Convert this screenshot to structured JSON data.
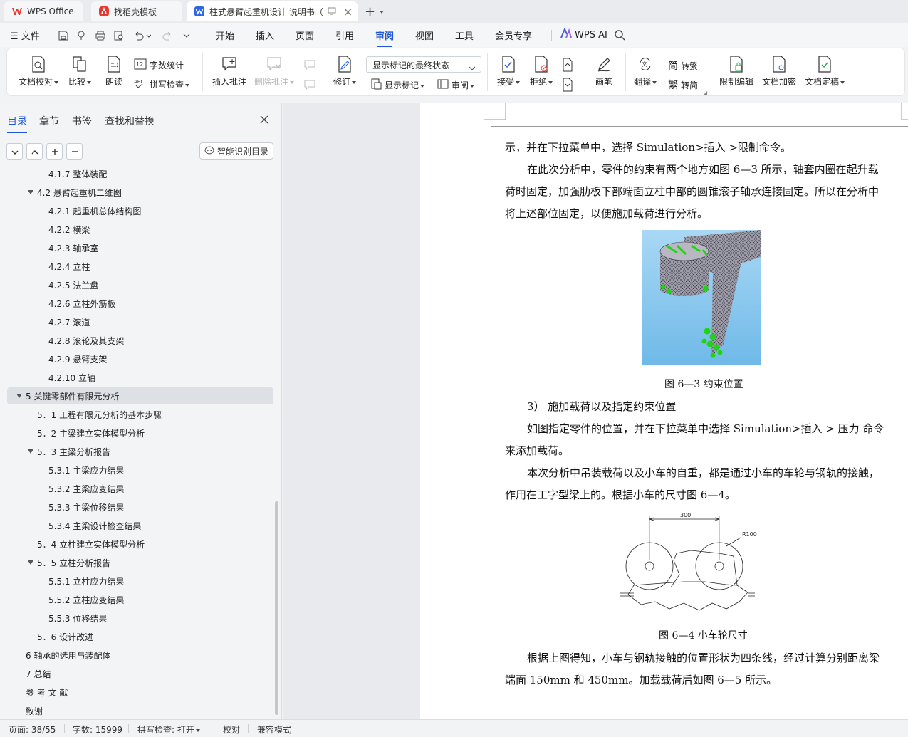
{
  "tabs": {
    "wps": "WPS Office",
    "template": "找稻壳模板",
    "document": "柱式悬臂起重机设计 说明书（",
    "close": "×",
    "new": "+"
  },
  "menu": {
    "file": "文件",
    "items": [
      "开始",
      "插入",
      "页面",
      "引用",
      "审阅",
      "视图",
      "工具",
      "会员专享"
    ],
    "active": "审阅",
    "wps_ai": "WPS AI"
  },
  "ribbon": {
    "doc_proof": "文档校对",
    "compare": "比较",
    "read_aloud": "朗读",
    "word_count": "字数统计",
    "spell_check": "拼写检查",
    "insert_comment": "插入批注",
    "delete_comment": "删除批注",
    "track_changes": "修订",
    "markup_state": "显示标记的最终状态",
    "show_markup": "显示标记",
    "review": "审阅",
    "accept": "接受",
    "reject": "拒绝",
    "pen": "画笔",
    "translate": "翻译",
    "to_traditional": "转繁",
    "to_simplified": "转简",
    "restrict_edit": "限制编辑",
    "doc_encrypt": "文档加密",
    "doc_finalize": "文档定稿"
  },
  "nav": {
    "tabs": [
      "目录",
      "章节",
      "书签",
      "查找和替换"
    ],
    "active_tab": "目录",
    "smart_toc": "智能识别目录",
    "toc": [
      {
        "label": "4.1.7  整体装配",
        "level": 3
      },
      {
        "label": "4.2   悬臂起重机二维图",
        "level": 2,
        "expanded": true
      },
      {
        "label": "4.2.1 起重机总体结构图",
        "level": 3
      },
      {
        "label": "4.2.2 横梁",
        "level": 3
      },
      {
        "label": "4.2.3 轴承室",
        "level": 3
      },
      {
        "label": "4.2.4 立柱",
        "level": 3
      },
      {
        "label": "4.2.5 法兰盘",
        "level": 3
      },
      {
        "label": "4.2.6 立柱外筋板",
        "level": 3
      },
      {
        "label": "4.2.7 滚道",
        "level": 3
      },
      {
        "label": "4.2.8 滚轮及其支架",
        "level": 3
      },
      {
        "label": "4.2.9 悬臂支架",
        "level": 3
      },
      {
        "label": "4.2.10 立轴",
        "level": 3
      },
      {
        "label": "5   关键零部件有限元分析",
        "level": 1,
        "expanded": true,
        "selected": true
      },
      {
        "label": "5．1   工程有限元分析的基本步骤",
        "level": 2
      },
      {
        "label": "5．2   主梁建立实体模型分析",
        "level": 2
      },
      {
        "label": "5．3   主梁分析报告",
        "level": 2,
        "expanded": true
      },
      {
        "label": "5.3.1    主梁应力结果",
        "level": 3
      },
      {
        "label": "5.3.2    主梁应变结果",
        "level": 3
      },
      {
        "label": "5.3.3    主梁位移结果",
        "level": 3
      },
      {
        "label": "5.3.4    主梁设计检查结果",
        "level": 3
      },
      {
        "label": "5．4   立柱建立实体模型分析",
        "level": 2
      },
      {
        "label": "5．5   立柱分析报告",
        "level": 2,
        "expanded": true
      },
      {
        "label": "5.5.1    立柱应力结果",
        "level": 3
      },
      {
        "label": "5.5.2    立柱应变结果",
        "level": 3
      },
      {
        "label": "5.5.3    位移结果",
        "level": 3
      },
      {
        "label": "5．6   设计改进",
        "level": 2
      },
      {
        "label": "6   轴承的选用与装配体",
        "level": 1
      },
      {
        "label": "7   总结",
        "level": 1
      },
      {
        "label": "参 考 文 献",
        "level": 1
      },
      {
        "label": "致谢",
        "level": 1
      }
    ]
  },
  "document": {
    "lines": [
      "示，并在下拉菜单中，选择 Simulation>插入  >限制命令。",
      "在此次分析中，零件的约束有两个地方如图 6—3 所示，轴套内圈在起升载",
      "荷时固定，加强肋板下部端面立柱中部的圆锥滚子轴承连接固定。所以在分析中",
      "将上述部位固定，以便施加载荷进行分析。"
    ],
    "fig3_caption": "图 6—3   约束位置",
    "step3_heading": "3）  施加载荷以及指定约束位置",
    "lines2": [
      "如图指定零件的位置，并在下拉菜单中选择 Simulation>插入  > 压力  命令",
      "来添加载荷。",
      "本次分析中吊装载荷以及小车的自重，都是通过小车的车轮与钢轨的接触，",
      "作用在工字型梁上的。根据小车的尺寸图 6—4。"
    ],
    "fig4_dim_width": "300",
    "fig4_dim_radius": "R100",
    "fig4_caption": "图 6—4   小车轮尺寸",
    "lines3": [
      "根据上图得知，小车与钢轨接触的位置形状为四条线，经过计算分别距离梁",
      "端面 150mm 和 450mm。加载载荷后如图 6—5 所示。"
    ]
  },
  "status": {
    "page": "页面: 38/55",
    "words": "字数: 15999",
    "spell": "拼写检查: 打开",
    "proof": "校对",
    "compat": "兼容模式"
  },
  "colors": {
    "accent": "#1f57d6",
    "wps_red": "#e8382f",
    "constraint_green": "#22d315",
    "mesh_blue": "#7ec3ee"
  }
}
